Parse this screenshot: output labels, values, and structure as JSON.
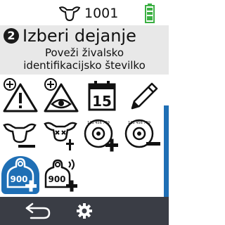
{
  "status": {
    "animal_id": "1001",
    "animal_icon": "cow-head-icon",
    "battery_icon": "battery-full-icon",
    "battery_color": "#3cb043"
  },
  "header": {
    "step": "2",
    "title": "Izberi dejanje",
    "subtitle_line1": "Poveži živalsko",
    "subtitle_line2": "identifikacijsko številko"
  },
  "actions": [
    {
      "icon": "add-warning-icon"
    },
    {
      "icon": "add-observation-icon"
    },
    {
      "icon": "calendar-icon",
      "text": "15"
    },
    {
      "icon": "edit-pencil-icon"
    },
    {
      "icon": "remove-animal-icon"
    },
    {
      "icon": "dead-animal-icon"
    },
    {
      "icon": "add-tag-number-icon",
      "text": "123 456 789"
    },
    {
      "icon": "remove-tag-number-icon",
      "text": "123 456 789"
    },
    {
      "icon": "add-ear-tag-icon",
      "text": "900",
      "selected": true
    },
    {
      "icon": "add-rfid-ear-tag-icon",
      "text": "900"
    }
  ],
  "colors": {
    "accent": "#1f6fb5",
    "header_bg": "#e8e8e8",
    "bottom_bar_bg": "#3a3d45"
  },
  "footer": {
    "back_icon": "back-arrow-icon",
    "settings_icon": "gear-icon"
  }
}
